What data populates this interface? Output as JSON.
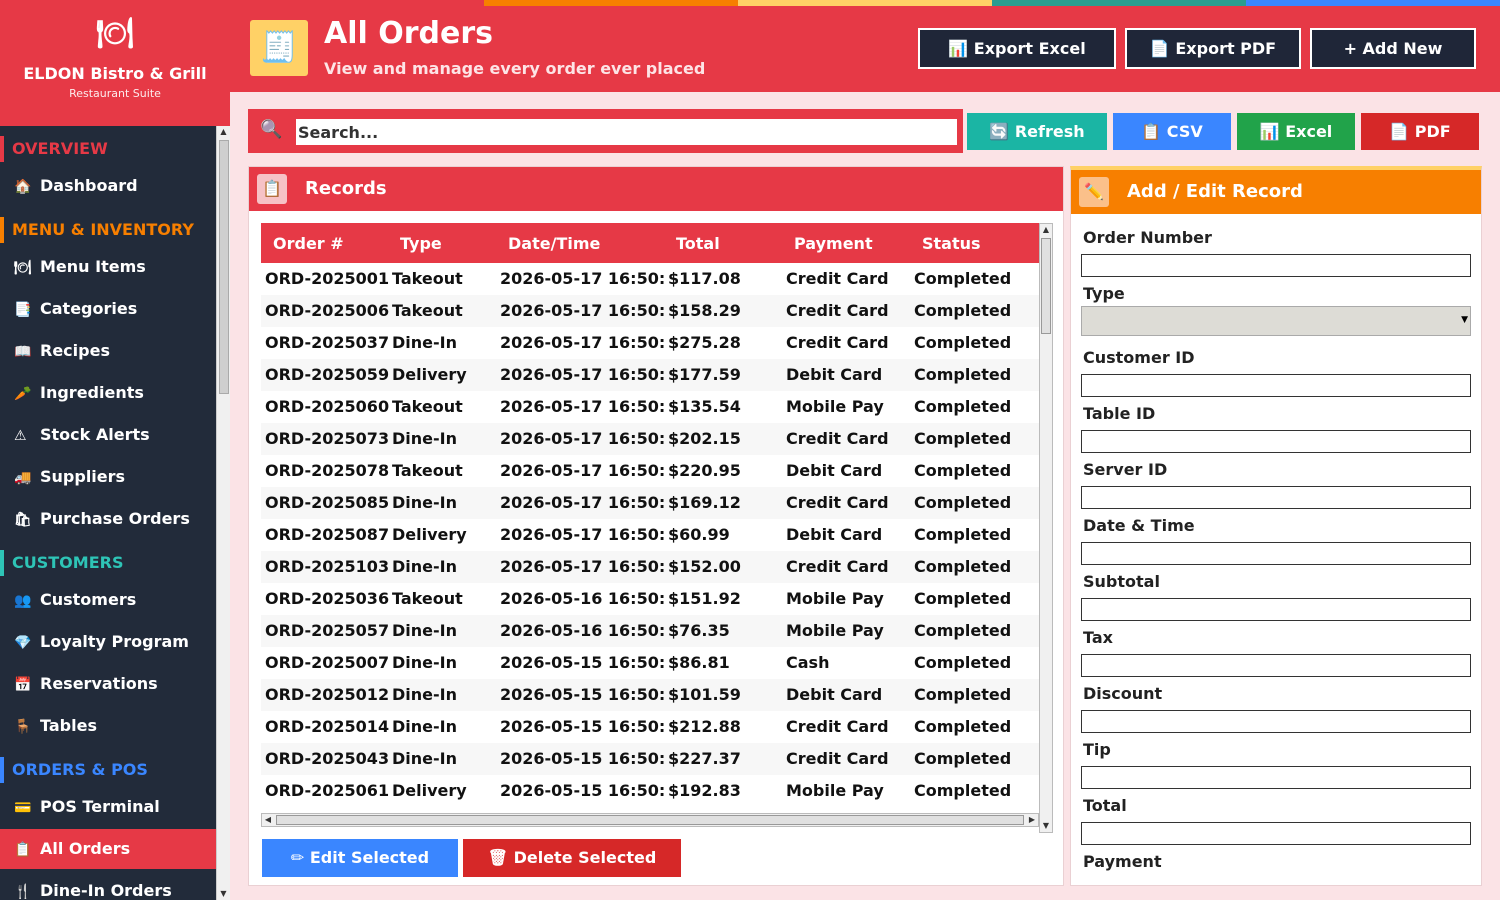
{
  "brand": {
    "logo": "🍽",
    "name": "ELDON Bistro & Grill",
    "sub": "Restaurant Suite"
  },
  "sidebar": {
    "sections": [
      {
        "title": "OVERVIEW",
        "items": [
          {
            "icon": "🏠",
            "label": "Dashboard"
          }
        ]
      },
      {
        "title": "MENU & INVENTORY",
        "items": [
          {
            "icon": "🍽",
            "label": "Menu Items"
          },
          {
            "icon": "📑",
            "label": "Categories"
          },
          {
            "icon": "📖",
            "label": "Recipes"
          },
          {
            "icon": "🥕",
            "label": "Ingredients"
          },
          {
            "icon": "⚠",
            "label": "Stock Alerts"
          },
          {
            "icon": "🚚",
            "label": "Suppliers"
          },
          {
            "icon": "🛍",
            "label": "Purchase Orders"
          }
        ]
      },
      {
        "title": "CUSTOMERS",
        "items": [
          {
            "icon": "👥",
            "label": "Customers"
          },
          {
            "icon": "💎",
            "label": "Loyalty Program"
          },
          {
            "icon": "📅",
            "label": "Reservations"
          },
          {
            "icon": "🪑",
            "label": "Tables"
          }
        ]
      },
      {
        "title": "ORDERS & POS",
        "items": [
          {
            "icon": "💳",
            "label": "POS Terminal"
          },
          {
            "icon": "📋",
            "label": "All Orders"
          },
          {
            "icon": "🍴",
            "label": "Dine-In Orders"
          }
        ]
      }
    ]
  },
  "header": {
    "icon": "🧾",
    "title": "All Orders",
    "subtitle": "View and manage every order ever placed",
    "buttons": [
      {
        "label": "📊 Export Excel"
      },
      {
        "label": "📄 Export PDF"
      },
      {
        "label": "+ Add New"
      }
    ]
  },
  "toolbar": {
    "search_placeholder": "Search...",
    "buttons": [
      {
        "label": "🔄 Refresh",
        "color": "#1bb5a4"
      },
      {
        "label": "📋 CSV",
        "color": "#3a86ff"
      },
      {
        "label": "📊 Excel",
        "color": "#21a34a"
      },
      {
        "label": "📄 PDF",
        "color": "#d62828"
      }
    ]
  },
  "records": {
    "icon": "📋",
    "title": "Records",
    "columns": [
      "Order #",
      "Type",
      "Date/Time",
      "Total",
      "Payment",
      "Status"
    ],
    "rows": [
      [
        "ORD-2025001",
        "Takeout",
        "2026-05-17 16:50:",
        "$117.08",
        "Credit Card",
        "Completed"
      ],
      [
        "ORD-2025006",
        "Takeout",
        "2026-05-17 16:50:",
        "$158.29",
        "Credit Card",
        "Completed"
      ],
      [
        "ORD-2025037",
        "Dine-In",
        "2026-05-17 16:50:",
        "$275.28",
        "Credit Card",
        "Completed"
      ],
      [
        "ORD-2025059",
        "Delivery",
        "2026-05-17 16:50:",
        "$177.59",
        "Debit Card",
        "Completed"
      ],
      [
        "ORD-2025060",
        "Takeout",
        "2026-05-17 16:50:",
        "$135.54",
        "Mobile Pay",
        "Completed"
      ],
      [
        "ORD-2025073",
        "Dine-In",
        "2026-05-17 16:50:",
        "$202.15",
        "Credit Card",
        "Completed"
      ],
      [
        "ORD-2025078",
        "Takeout",
        "2026-05-17 16:50:",
        "$220.95",
        "Debit Card",
        "Completed"
      ],
      [
        "ORD-2025085",
        "Dine-In",
        "2026-05-17 16:50:",
        "$169.12",
        "Credit Card",
        "Completed"
      ],
      [
        "ORD-2025087",
        "Delivery",
        "2026-05-17 16:50:",
        "$60.99",
        "Debit Card",
        "Completed"
      ],
      [
        "ORD-2025103",
        "Dine-In",
        "2026-05-17 16:50:",
        "$152.00",
        "Credit Card",
        "Completed"
      ],
      [
        "ORD-2025036",
        "Takeout",
        "2026-05-16 16:50:",
        "$151.92",
        "Mobile Pay",
        "Completed"
      ],
      [
        "ORD-2025057",
        "Dine-In",
        "2026-05-16 16:50:",
        "$76.35",
        "Mobile Pay",
        "Completed"
      ],
      [
        "ORD-2025007",
        "Dine-In",
        "2026-05-15 16:50:",
        "$86.81",
        "Cash",
        "Completed"
      ],
      [
        "ORD-2025012",
        "Dine-In",
        "2026-05-15 16:50:",
        "$101.59",
        "Debit Card",
        "Completed"
      ],
      [
        "ORD-2025014",
        "Dine-In",
        "2026-05-15 16:50:",
        "$212.88",
        "Credit Card",
        "Completed"
      ],
      [
        "ORD-2025043",
        "Dine-In",
        "2026-05-15 16:50:",
        "$227.37",
        "Credit Card",
        "Completed"
      ],
      [
        "ORD-2025061",
        "Delivery",
        "2026-05-15 16:50:",
        "$192.83",
        "Mobile Pay",
        "Completed"
      ]
    ],
    "edit_label": "✏ Edit Selected",
    "delete_label": "🗑 Delete Selected"
  },
  "form": {
    "icon": "✏️",
    "title": "Add / Edit Record",
    "fields": [
      "Order Number",
      "Type",
      "Customer ID",
      "Table ID",
      "Server ID",
      "Date & Time",
      "Subtotal",
      "Tax",
      "Discount",
      "Tip",
      "Total",
      "Payment"
    ]
  },
  "colors": {
    "accent": "#e63946",
    "orange": "#f77f00",
    "dark": "#222b3a"
  }
}
